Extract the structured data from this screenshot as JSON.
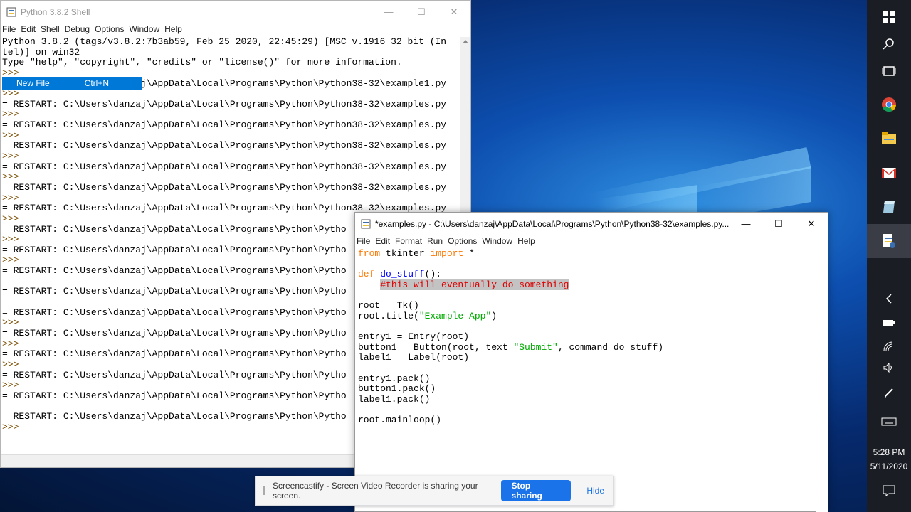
{
  "shell": {
    "title": "Python 3.8.2 Shell",
    "menu": [
      "File",
      "Edit",
      "Shell",
      "Debug",
      "Options",
      "Window",
      "Help"
    ],
    "lines": [
      {
        "t": "Python 3.8.2 (tags/v3.8.2:7b3ab59, Feb 25 2020, 22:45:29) [MSC v.1916 32 bit (In",
        "c": "outl"
      },
      {
        "t": "tel)] on win32",
        "c": "outl"
      },
      {
        "t": "Type \"help\", \"copyright\", \"credits\" or \"license()\" for more information.",
        "c": "outl"
      },
      {
        "t": ">>>",
        "c": "prompt"
      },
      {
        "t": "= RESTART: C:\\Users\\danzaj\\AppData\\Local\\Programs\\Python\\Python38-32\\example1.py",
        "c": "outl"
      },
      {
        "t": ">>>",
        "c": "prompt"
      },
      {
        "t": "= RESTART: C:\\Users\\danzaj\\AppData\\Local\\Programs\\Python\\Python38-32\\examples.py",
        "c": "outl"
      },
      {
        "t": ">>>",
        "c": "prompt"
      },
      {
        "t": "= RESTART: C:\\Users\\danzaj\\AppData\\Local\\Programs\\Python\\Python38-32\\examples.py",
        "c": "outl"
      },
      {
        "t": ">>>",
        "c": "prompt"
      },
      {
        "t": "= RESTART: C:\\Users\\danzaj\\AppData\\Local\\Programs\\Python\\Python38-32\\examples.py",
        "c": "outl"
      },
      {
        "t": ">>>",
        "c": "prompt"
      },
      {
        "t": "= RESTART: C:\\Users\\danzaj\\AppData\\Local\\Programs\\Python\\Python38-32\\examples.py",
        "c": "outl"
      },
      {
        "t": ">>>",
        "c": "prompt"
      },
      {
        "t": "= RESTART: C:\\Users\\danzaj\\AppData\\Local\\Programs\\Python\\Python38-32\\examples.py",
        "c": "outl"
      },
      {
        "t": ">>>",
        "c": "prompt"
      },
      {
        "t": "= RESTART: C:\\Users\\danzaj\\AppData\\Local\\Programs\\Python\\Python38-32\\examples.py",
        "c": "outl"
      },
      {
        "t": ">>>",
        "c": "prompt"
      },
      {
        "t": "= RESTART: C:\\Users\\danzaj\\AppData\\Local\\Programs\\Python\\Pytho",
        "c": "outl"
      },
      {
        "t": ">>>",
        "c": "prompt"
      },
      {
        "t": "= RESTART: C:\\Users\\danzaj\\AppData\\Local\\Programs\\Python\\Pytho",
        "c": "outl"
      },
      {
        "t": ">>>",
        "c": "prompt"
      },
      {
        "t": "= RESTART: C:\\Users\\danzaj\\AppData\\Local\\Programs\\Python\\Pytho",
        "c": "outl"
      },
      {
        "t": "",
        "c": "outl"
      },
      {
        "t": "= RESTART: C:\\Users\\danzaj\\AppData\\Local\\Programs\\Python\\Pytho",
        "c": "outl"
      },
      {
        "t": "",
        "c": "outl"
      },
      {
        "t": "= RESTART: C:\\Users\\danzaj\\AppData\\Local\\Programs\\Python\\Pytho",
        "c": "outl"
      },
      {
        "t": ">>>",
        "c": "prompt"
      },
      {
        "t": "= RESTART: C:\\Users\\danzaj\\AppData\\Local\\Programs\\Python\\Pytho",
        "c": "outl"
      },
      {
        "t": ">>>",
        "c": "prompt"
      },
      {
        "t": "= RESTART: C:\\Users\\danzaj\\AppData\\Local\\Programs\\Python\\Pytho",
        "c": "outl"
      },
      {
        "t": ">>>",
        "c": "prompt"
      },
      {
        "t": "= RESTART: C:\\Users\\danzaj\\AppData\\Local\\Programs\\Python\\Pytho",
        "c": "outl"
      },
      {
        "t": ">>>",
        "c": "prompt"
      },
      {
        "t": "= RESTART: C:\\Users\\danzaj\\AppData\\Local\\Programs\\Python\\Pytho",
        "c": "outl"
      },
      {
        "t": "",
        "c": "outl"
      },
      {
        "t": "= RESTART: C:\\Users\\danzaj\\AppData\\Local\\Programs\\Python\\Pytho",
        "c": "outl"
      },
      {
        "t": ">>>",
        "c": "prompt"
      }
    ],
    "context_menu": {
      "label": "New File",
      "shortcut": "Ctrl+N"
    }
  },
  "editor": {
    "title": "*examples.py - C:\\Users\\danzaj\\AppData\\Local\\Programs\\Python\\Python38-32\\examples.py...",
    "menu": [
      "File",
      "Edit",
      "Format",
      "Run",
      "Options",
      "Window",
      "Help"
    ],
    "code": [
      [
        [
          "from",
          "kw"
        ],
        [
          " tkinter ",
          ""
        ],
        [
          "import",
          "kw"
        ],
        [
          " *",
          ""
        ]
      ],
      [],
      [
        [
          "def",
          "kw"
        ],
        [
          " ",
          ""
        ],
        [
          "do_stuff",
          "fn"
        ],
        [
          "():",
          ""
        ]
      ],
      [
        [
          "    ",
          ""
        ],
        [
          "#this will eventually do something",
          "cm"
        ]
      ],
      [],
      [
        [
          "root = Tk()",
          ""
        ]
      ],
      [
        [
          "root.title(",
          ""
        ],
        [
          "\"Example App\"",
          "st"
        ],
        [
          ")",
          ""
        ]
      ],
      [],
      [
        [
          "entry1 = Entry(root)",
          ""
        ]
      ],
      [
        [
          "button1 = Button(root, text=",
          ""
        ],
        [
          "\"Submit\"",
          "st"
        ],
        [
          ", command=do_stuff)",
          ""
        ]
      ],
      [
        [
          "label1 = Label(root)",
          ""
        ]
      ],
      [],
      [
        [
          "entry1.pack()",
          ""
        ]
      ],
      [
        [
          "button1.pack()",
          ""
        ]
      ],
      [
        [
          "label1.pack()",
          ""
        ]
      ],
      [],
      [
        [
          "root.mainloop()",
          ""
        ]
      ]
    ]
  },
  "share_bar": {
    "message": "Screencastify - Screen Video Recorder is sharing your screen.",
    "stop_label": "Stop sharing",
    "hide_label": "Hide"
  },
  "taskbar": {
    "time": "5:28 PM",
    "date": "5/11/2020",
    "icons": [
      "windows-start-icon",
      "search-icon",
      "task-view-icon",
      "chrome-icon",
      "file-explorer-icon",
      "gmail-icon",
      "app-icon",
      "python-idle-icon"
    ]
  },
  "colors": {
    "accent": "#0078d7",
    "share_button": "#1a73e8",
    "keyword": "#ff7700",
    "string": "#00aa00",
    "function": "#0000ff"
  }
}
